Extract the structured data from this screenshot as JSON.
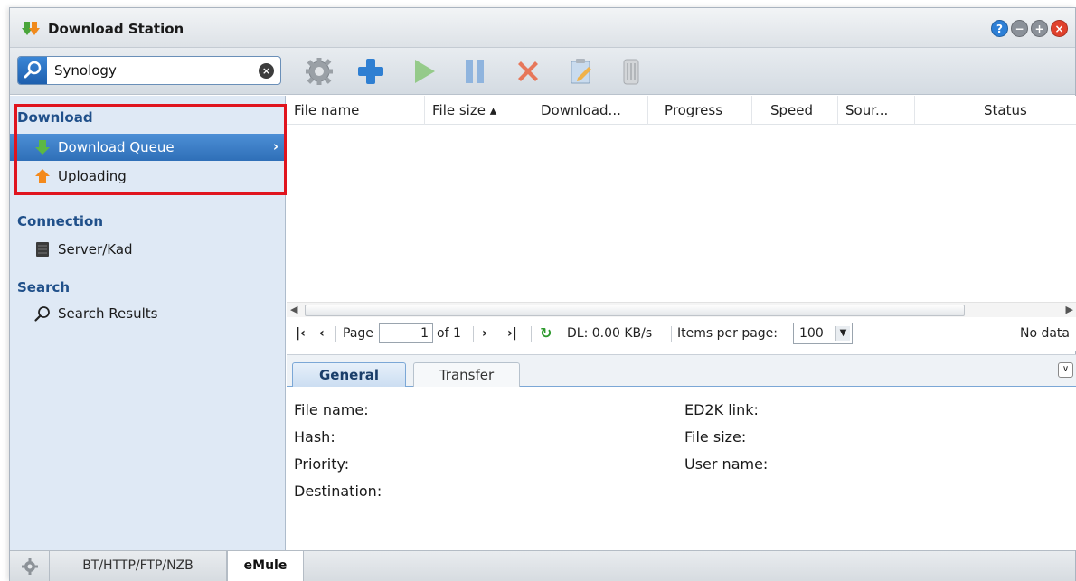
{
  "window": {
    "title": "Download Station",
    "buttons": [
      "help",
      "minimize",
      "maximize",
      "close"
    ]
  },
  "toolbar": {
    "search_value": "Synology",
    "search_placeholder": "",
    "icons": [
      "settings-icon",
      "add-icon",
      "resume-icon",
      "pause-icon",
      "delete-icon",
      "edit-icon",
      "clear-icon"
    ]
  },
  "sidebar": {
    "sections": [
      {
        "label": "Download",
        "items": [
          {
            "label": "Download Queue",
            "icon": "download-arrow-icon",
            "selected": true
          },
          {
            "label": "Uploading",
            "icon": "upload-arrow-icon",
            "selected": false
          }
        ]
      },
      {
        "label": "Connection",
        "items": [
          {
            "label": "Server/Kad",
            "icon": "server-icon",
            "selected": false
          }
        ]
      },
      {
        "label": "Search",
        "items": [
          {
            "label": "Search Results",
            "icon": "search-icon",
            "selected": false
          }
        ]
      }
    ]
  },
  "grid": {
    "columns": [
      "File name",
      "File size ▴",
      "Download...",
      "Progress",
      "Speed",
      "Sour...",
      "Status"
    ],
    "rows": []
  },
  "pager": {
    "page_label": "Page",
    "page_value": "1",
    "of_label": "of 1",
    "dl_speed": "DL: 0.00 KB/s",
    "items_per_page_label": "Items per page:",
    "items_per_page_value": "100",
    "status": "No data"
  },
  "details": {
    "tabs": [
      "General",
      "Transfer"
    ],
    "active_tab": "General",
    "fields_left": [
      "File name:",
      "Hash:",
      "Priority:",
      "Destination:"
    ],
    "fields_right": [
      "ED2K link:",
      "File size:",
      "User name:"
    ]
  },
  "bottom_tabs": [
    "BT/HTTP/FTP/NZB",
    "eMule"
  ],
  "active_bottom_tab": "eMule",
  "colors": {
    "selected_item": "#2f6fb8",
    "highlight_box": "#e0141e",
    "section_heading": "#20508a"
  }
}
